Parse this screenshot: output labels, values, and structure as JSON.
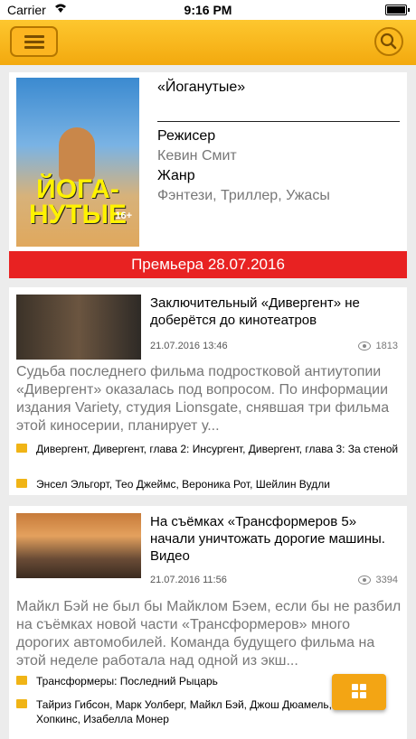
{
  "status_bar": {
    "carrier": "Carrier",
    "time": "9:16 PM",
    "battery_level": 1.0
  },
  "app_bar": {
    "menu_icon": "hamburger-icon",
    "search_icon": "search-icon",
    "accent": "#f7b319"
  },
  "featured_movie": {
    "title": "«Йоганутые»",
    "director_label": "Режисер",
    "director": "Кевин Смит",
    "genre_label": "Жанр",
    "genres": "Фэнтези, Триллер, Ужасы",
    "premiere": "Премьера 28.07.2016",
    "poster_title": "ЙОГА-НУТЫЕ",
    "poster_age": "16+"
  },
  "news": [
    {
      "title": "Заключительный «Дивергент» не доберётся до кинотеатров",
      "date": "21.07.2016 13:46",
      "views": "1813",
      "description": "Судьба последнего фильма подростковой антиутопии «Дивергент» оказалась под вопросом. По информации издания Variety, студия Lionsgate, снявшая три фильма этой киносерии, планирует у...",
      "movies": "Дивергент, Дивергент, глава 2: Инсургент, Дивергент, глава 3: За стеной",
      "people": "Энсел Эльгорт, Тео Джеймс,  Вероника Рот, Шейлин Вудли"
    },
    {
      "title": "На съёмках «Трансформеров 5» начали уничтожать дорогие машины. Видео",
      "date": "21.07.2016 11:56",
      "views": "3394",
      "description": "Майкл Бэй не был бы Майклом Бэем, если бы не разбил на съёмках новой части «Трансформеров» много дорогих автомобилей. Команда будущего фильма на этой неделе работала над одной из экш...",
      "movies": "Трансформеры: Последний Рыцарь",
      "people": "Тайриз Гибсон, Марк Уолберг, Майкл Бэй, Джош Дюамель, Энтони Хопкинс, Изабелла Монер"
    }
  ],
  "fab": {
    "icon": "grid-icon"
  }
}
